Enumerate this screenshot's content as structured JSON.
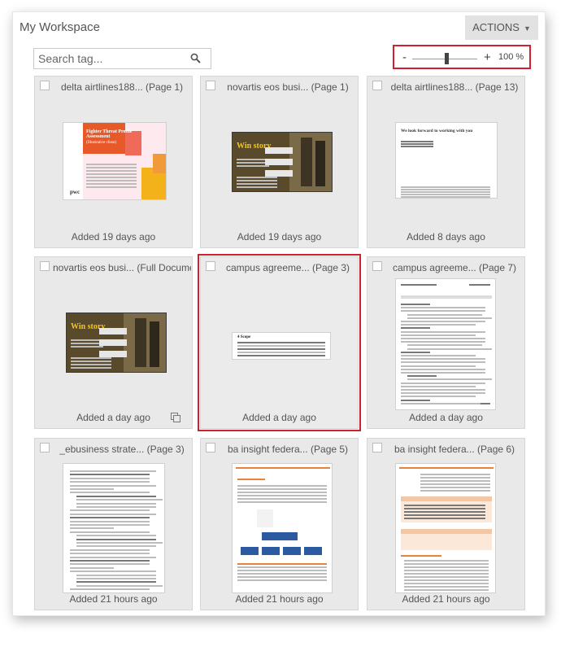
{
  "workspace": {
    "title": "My Workspace",
    "actions_label": "ACTIONS"
  },
  "search": {
    "placeholder": "Search tag..."
  },
  "zoom": {
    "minus": "-",
    "plus": "+",
    "level_label": "100 %",
    "slider_value": 0.52
  },
  "cards": [
    {
      "title": "delta airtlines188... (Page 1)",
      "added": "Added 19 days ago",
      "selected": false,
      "thumb": "pwc"
    },
    {
      "title": "novartis eos busi... (Page 1)",
      "added": "Added 19 days ago",
      "selected": false,
      "thumb": "winstory"
    },
    {
      "title": "delta airtlines188... (Page 13)",
      "added": "Added 8 days ago",
      "selected": false,
      "thumb": "letter"
    },
    {
      "title": "novartis eos busi... (Full Document)",
      "added": "Added a day ago",
      "selected": false,
      "thumb": "winstory",
      "has_copy_icon": true
    },
    {
      "title": "campus agreeme... (Page 3)",
      "added": "Added a day ago",
      "selected": true,
      "thumb": "snippet"
    },
    {
      "title": "campus agreeme... (Page 7)",
      "added": "Added a day ago",
      "selected": false,
      "thumb": "textdoc"
    },
    {
      "title": "_ebusiness strate... (Page 3)",
      "added": "Added 21 hours ago",
      "selected": false,
      "thumb": "densetext"
    },
    {
      "title": "ba insight federa... (Page 5)",
      "added": "Added 21 hours ago",
      "selected": false,
      "thumb": "diagram"
    },
    {
      "title": "ba insight federa... (Page 6)",
      "added": "Added 21 hours ago",
      "selected": false,
      "thumb": "table"
    }
  ],
  "thumb_text": {
    "pwc_heading": "Fighter Threat Profile Assessment",
    "pwc_sub": "(Illustrative client)",
    "pwc_logo": "pwc",
    "winstory_heading": "Win story",
    "letter_heading": "We look forward to working with you",
    "snippet_heading": "4  Scope"
  },
  "colors": {
    "selected_border": "#d01f2f",
    "card_bg": "#e9e9e9",
    "actions_bg": "#e2e2e2",
    "winstory_bg": "#5a4a2c",
    "winstory_title": "#f5c518",
    "pwc_orange": "#e8592a",
    "pwc_yellow": "#f3b21a",
    "ba_orange": "#e8833a"
  }
}
